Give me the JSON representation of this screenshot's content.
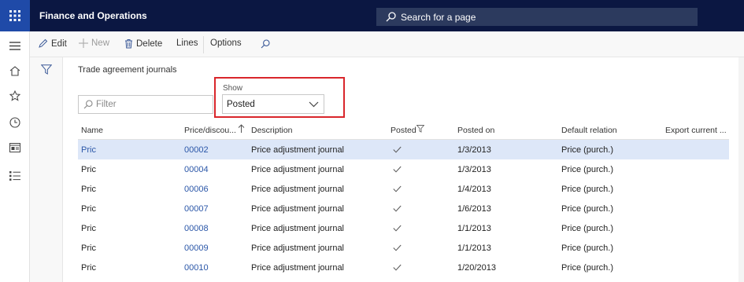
{
  "header": {
    "app_title": "Finance and Operations",
    "search_label": "Search for a page"
  },
  "leftnav": {
    "icons": [
      "hamburger-icon",
      "home-icon",
      "star-icon",
      "recent-clock-icon",
      "workspaces-icon",
      "modules-list-icon"
    ]
  },
  "actionbar": {
    "edit_label": "Edit",
    "new_label": "New",
    "delete_label": "Delete",
    "lines_label": "Lines",
    "options_label": "Options"
  },
  "page": {
    "title": "Trade agreement journals",
    "filter_placeholder": "Filter",
    "show_label": "Show",
    "show_value": "Posted"
  },
  "grid": {
    "columns": [
      "Name",
      "Price/discou...",
      "Description",
      "Posted",
      "Posted on",
      "Default relation",
      "Export current ..."
    ],
    "rows": [
      {
        "name": "Pric",
        "journal": "00002",
        "description": "Price adjustment journal",
        "posted": true,
        "posted_on": "1/3/2013",
        "relation": "Price (purch.)",
        "export": ""
      },
      {
        "name": "Pric",
        "journal": "00004",
        "description": "Price adjustment journal",
        "posted": true,
        "posted_on": "1/3/2013",
        "relation": "Price (purch.)",
        "export": ""
      },
      {
        "name": "Pric",
        "journal": "00006",
        "description": "Price adjustment journal",
        "posted": true,
        "posted_on": "1/4/2013",
        "relation": "Price (purch.)",
        "export": ""
      },
      {
        "name": "Pric",
        "journal": "00007",
        "description": "Price adjustment journal",
        "posted": true,
        "posted_on": "1/6/2013",
        "relation": "Price (purch.)",
        "export": ""
      },
      {
        "name": "Pric",
        "journal": "00008",
        "description": "Price adjustment journal",
        "posted": true,
        "posted_on": "1/1/2013",
        "relation": "Price (purch.)",
        "export": ""
      },
      {
        "name": "Pric",
        "journal": "00009",
        "description": "Price adjustment journal",
        "posted": true,
        "posted_on": "1/1/2013",
        "relation": "Price (purch.)",
        "export": ""
      },
      {
        "name": "Pric",
        "journal": "00010",
        "description": "Price adjustment journal",
        "posted": true,
        "posted_on": "1/20/2013",
        "relation": "Price (purch.)",
        "export": ""
      }
    ]
  },
  "colors": {
    "topbar": "#0b1742",
    "waffle": "#1f4aa8",
    "selected_row": "#dde7f8",
    "highlight_box": "#d9262b",
    "link": "#2b57a8"
  }
}
